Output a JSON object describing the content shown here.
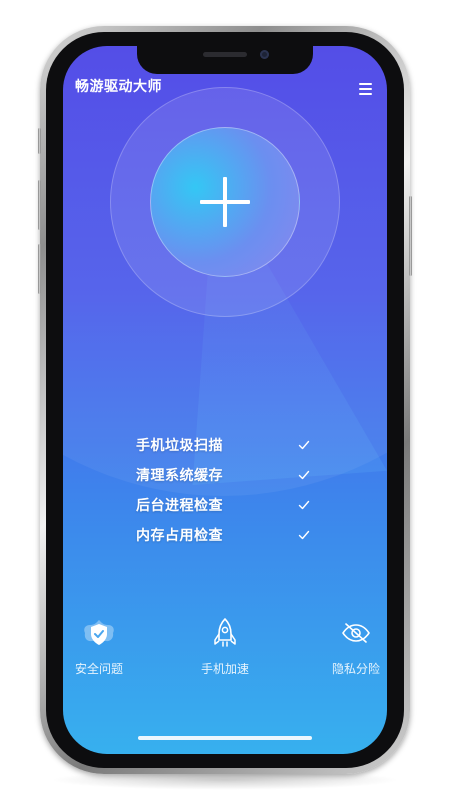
{
  "app": {
    "title": "畅游驱动大师",
    "menu_icon": "hamburger-menu-icon"
  },
  "scan_button": {
    "icon": "plus-icon"
  },
  "checklist": [
    {
      "label": "手机垃圾扫描",
      "icon": "checkmark-icon"
    },
    {
      "label": "清理系统缓存",
      "icon": "checkmark-icon"
    },
    {
      "label": "后台进程检查",
      "icon": "checkmark-icon"
    },
    {
      "label": "内存占用检查",
      "icon": "checkmark-icon"
    }
  ],
  "bottom_nav": [
    {
      "label": "安全问题",
      "icon": "shield-check-icon"
    },
    {
      "label": "手机加速",
      "icon": "rocket-icon"
    },
    {
      "label": "隐私分险",
      "icon": "eye-off-icon"
    }
  ],
  "colors": {
    "gradient_top": "#4a43e6",
    "gradient_bottom": "#37b0ee",
    "accent_inner": "#34c7f4",
    "text": "#ffffff"
  }
}
